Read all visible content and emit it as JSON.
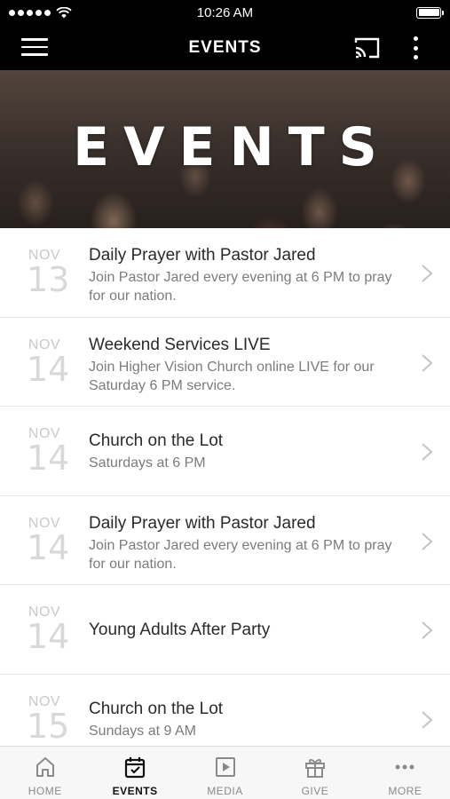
{
  "status_bar": {
    "time": "10:26 AM"
  },
  "nav": {
    "title": "EVENTS"
  },
  "hero": {
    "text": "EVENTS"
  },
  "events": [
    {
      "month": "NOV",
      "day": "13",
      "title": "Daily Prayer with Pastor Jared",
      "description": "Join Pastor Jared every evening at 6 PM to pray for our nation."
    },
    {
      "month": "NOV",
      "day": "14",
      "title": "Weekend Services LIVE",
      "description": "Join Higher Vision Church online LIVE for our Saturday 6 PM service."
    },
    {
      "month": "NOV",
      "day": "14",
      "title": "Church on the Lot",
      "description": "Saturdays at 6 PM"
    },
    {
      "month": "NOV",
      "day": "14",
      "title": "Daily Prayer with Pastor Jared",
      "description": "Join Pastor Jared every evening at 6 PM to pray for our nation."
    },
    {
      "month": "NOV",
      "day": "14",
      "title": "Young Adults After Party",
      "description": ""
    },
    {
      "month": "NOV",
      "day": "15",
      "title": "Church on the Lot",
      "description": "Sundays at 9 AM"
    }
  ],
  "tabs": [
    {
      "label": "HOME",
      "icon": "home-icon",
      "active": false
    },
    {
      "label": "EVENTS",
      "icon": "calendar-icon",
      "active": true
    },
    {
      "label": "MEDIA",
      "icon": "media-play-icon",
      "active": false
    },
    {
      "label": "GIVE",
      "icon": "gift-icon",
      "active": false
    },
    {
      "label": "MORE",
      "icon": "more-dots-icon",
      "active": false
    }
  ],
  "colors": {
    "bar_background": "#000000",
    "date_text": "#c9c9c9",
    "title_text": "#2a2a2a",
    "desc_text": "#7c7c7c",
    "active_tab": "#111111",
    "inactive_tab": "#8a8a8a"
  }
}
